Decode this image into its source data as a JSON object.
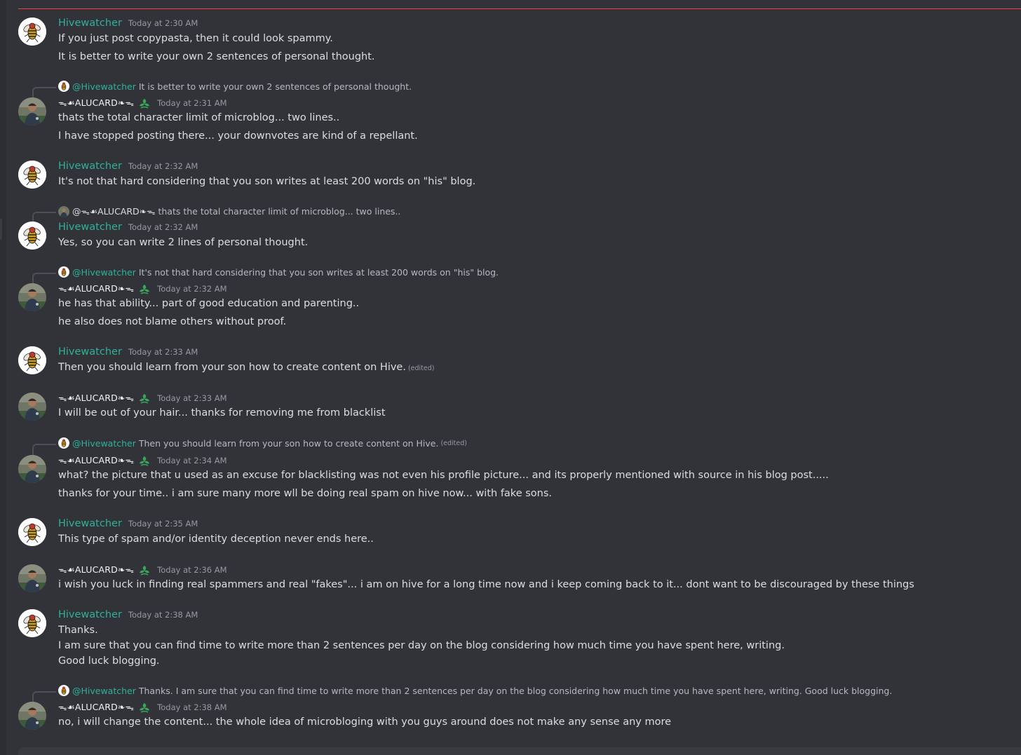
{
  "channel": {
    "new_divider_color": "#f23f43"
  },
  "colors": {
    "hivewatcher": "#2fb19a",
    "alucard": "#f2f3f5",
    "timestamp": "#949ba4",
    "text": "#dbdee1",
    "background": "#313338"
  },
  "icons": {
    "hivewatcher_avatar": "bee-avatar-icon",
    "alucard_avatar": "user-photo-avatar-icon",
    "badge": "leaf-badge-icon"
  },
  "messages": [
    {
      "author": "Hivewatcher",
      "time": "Today at 2:30 AM",
      "lines": [
        "If you just post copypasta, then it could look spammy.",
        "It is better to write your own 2 sentences of personal thought."
      ]
    },
    {
      "reply": {
        "mention": "@Hivewatcher",
        "text": "It is better to write your own 2 sentences of personal thought."
      },
      "author": "ᯓ☙ALUCARD❧ᯓ",
      "time": "Today at 2:31 AM",
      "lines": [
        "thats the total character limit of microblog... two lines..",
        "I have stopped posting there... your downvotes are kind of a repellant."
      ]
    },
    {
      "author": "Hivewatcher",
      "time": "Today at 2:32 AM",
      "lines": [
        "It's not that hard considering that you son writes at least 200 words on \"his\" blog."
      ]
    },
    {
      "reply": {
        "mention": "@ᯓ☙ALUCARD❧ᯓ",
        "text": "thats the total character limit of microblog... two lines.."
      },
      "author": "Hivewatcher",
      "time": "Today at 2:32 AM",
      "lines": [
        "Yes, so you can write 2 lines of personal thought."
      ]
    },
    {
      "reply": {
        "mention": "@Hivewatcher",
        "text": "It's not that hard considering that you son writes at least 200 words on \"his\" blog."
      },
      "author": "ᯓ☙ALUCARD❧ᯓ",
      "time": "Today at 2:32 AM",
      "lines": [
        "he has that ability... part of good education and parenting..",
        "he also does not blame others without proof."
      ]
    },
    {
      "author": "Hivewatcher",
      "time": "Today at 2:33 AM",
      "lines": [
        "Then you should learn from your son how to create content on Hive."
      ],
      "edited": "(edited)"
    },
    {
      "author": "ᯓ☙ALUCARD❧ᯓ",
      "time": "Today at 2:33 AM",
      "lines": [
        "I will be out of your hair... thanks for removing me from blacklist"
      ]
    },
    {
      "reply": {
        "mention": "@Hivewatcher",
        "text": "Then you should learn from your son how to create content on Hive.",
        "edited": "(edited)"
      },
      "author": "ᯓ☙ALUCARD❧ᯓ",
      "time": "Today at 2:34 AM",
      "lines": [
        "what? the picture that u used as an excuse for blacklisting was not even his profile picture... and its properly mentioned with source in his blog post.....",
        "thanks for your time.. i am sure many more wll be doing real spam on hive now... with fake sons."
      ]
    },
    {
      "author": "Hivewatcher",
      "time": "Today at 2:35 AM",
      "lines": [
        "This type of spam and/or identity deception never ends here.."
      ]
    },
    {
      "author": "ᯓ☙ALUCARD❧ᯓ",
      "time": "Today at 2:36 AM",
      "lines": [
        "i wish you luck in finding real spammers and real \"fakes\"... i am on hive for a long time now and i keep coming back to it... dont want to be discouraged by these things"
      ]
    },
    {
      "author": "Hivewatcher",
      "time": "Today at 2:38 AM",
      "lines": [
        "Thanks.",
        "I am sure that you can find time to write more than 2 sentences per day on the blog considering how much time you have spent here, writing.",
        "Good luck blogging."
      ]
    },
    {
      "reply": {
        "mention": "@Hivewatcher",
        "text": "Thanks.  I am sure that you can find time to write more than 2 sentences per day on the blog considering how much time you have spent here, writing. Good luck blogging."
      },
      "author": "ᯓ☙ALUCARD❧ᯓ",
      "time": "Today at 2:38 AM",
      "lines": [
        "no, i will change the content... the whole idea of microbloging with you guys around does not make any sense any more"
      ]
    }
  ]
}
